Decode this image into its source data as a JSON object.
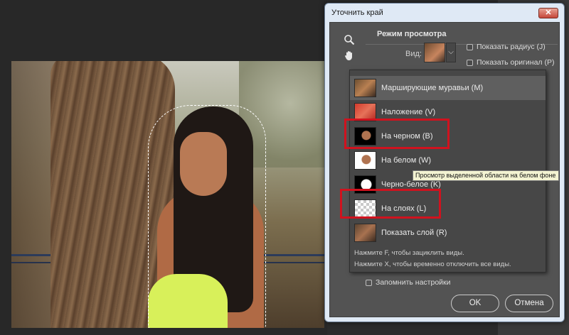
{
  "dialog": {
    "title": "Уточнить край",
    "close_label": "✕",
    "section_title": "Режим просмотра",
    "view_label": "Вид:",
    "show_radius": "Показать радиус (J)",
    "show_original": "Показать оригинал (P)",
    "menu": {
      "items": [
        {
          "label": "Марширующие муравьи (M)",
          "thumb": "t-ants"
        },
        {
          "label": "Наложение (V)",
          "thumb": "t-overlay"
        },
        {
          "label": "На черном (B)",
          "thumb": "t-black"
        },
        {
          "label": "На белом (W)",
          "thumb": "t-white"
        },
        {
          "label": "Черно-белое (K)",
          "thumb": "t-bw"
        },
        {
          "label": "На слоях (L)",
          "thumb": "t-layers"
        },
        {
          "label": "Показать слой (R)",
          "thumb": "t-show"
        }
      ],
      "hint1": "Нажмите F, чтобы зациклить виды.",
      "hint2": "Нажмите X, чтобы временно отключить все виды."
    },
    "remember": "Запомнить настройки",
    "ok_label": "OK",
    "cancel_label": "Отмена"
  },
  "tooltip": "Просмотр выделенной области на белом фоне",
  "tools": {
    "zoom": "zoom-icon",
    "hand": "hand-icon"
  },
  "colors": {
    "highlight": "#d0121e",
    "dialog_bg": "#535353",
    "titlebar": "#dfe9f5"
  }
}
